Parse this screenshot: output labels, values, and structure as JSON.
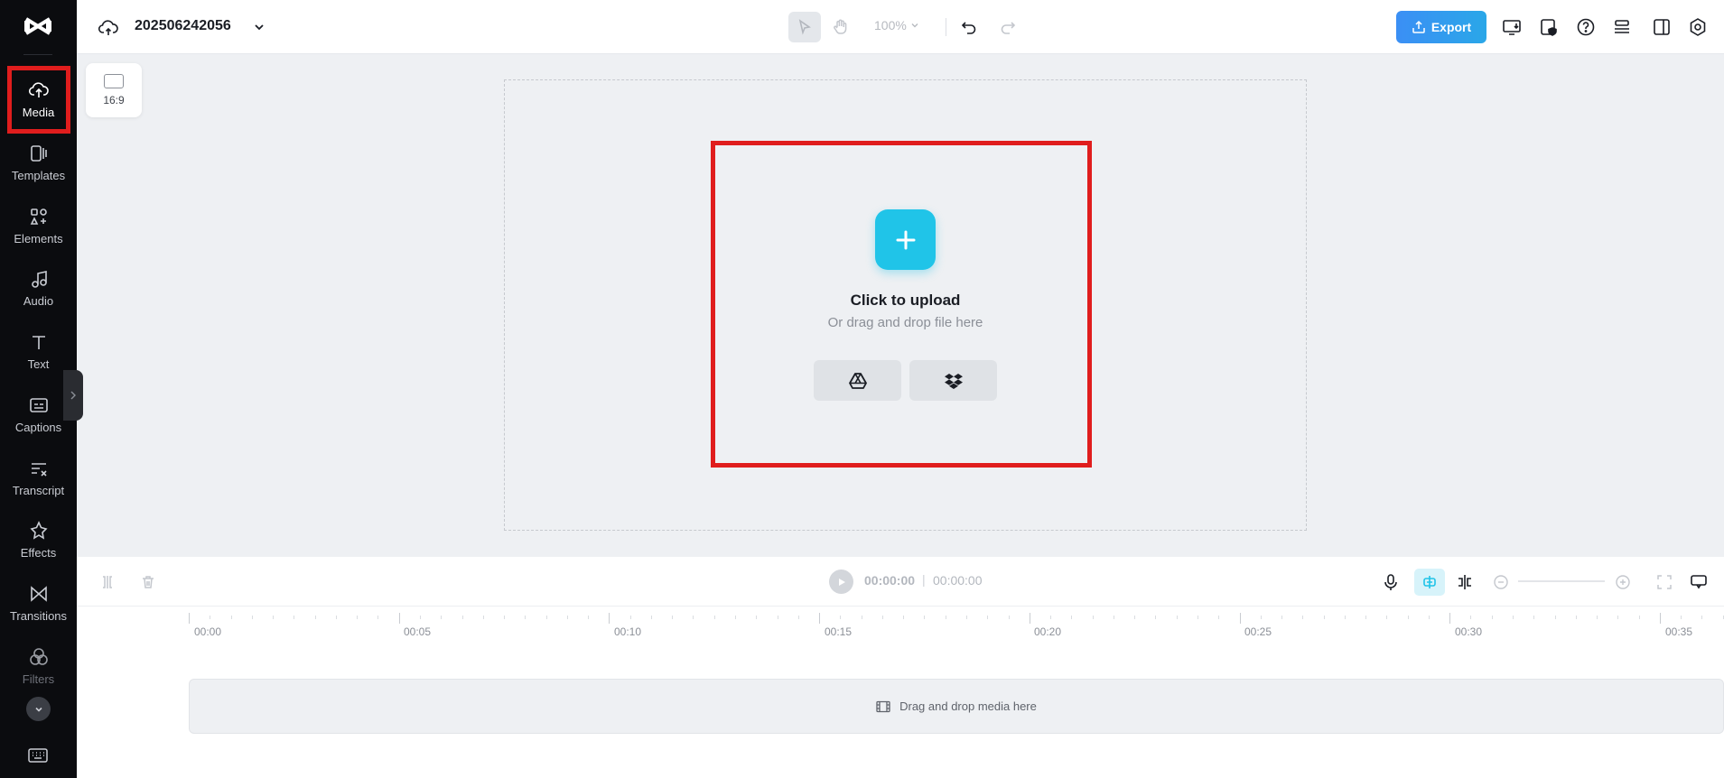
{
  "sidebar": {
    "items": [
      {
        "label": "Media",
        "icon": "cloud-upload-icon"
      },
      {
        "label": "Templates",
        "icon": "templates-icon"
      },
      {
        "label": "Elements",
        "icon": "elements-icon"
      },
      {
        "label": "Audio",
        "icon": "music-note-icon"
      },
      {
        "label": "Text",
        "icon": "text-icon"
      },
      {
        "label": "Captions",
        "icon": "captions-icon"
      },
      {
        "label": "Transcript",
        "icon": "transcript-icon"
      },
      {
        "label": "Effects",
        "icon": "effects-icon"
      },
      {
        "label": "Transitions",
        "icon": "transitions-icon"
      },
      {
        "label": "Filters",
        "icon": "filters-icon"
      }
    ],
    "active": "Media"
  },
  "header": {
    "project_name": "202506242056",
    "zoom": "100%",
    "export_label": "Export"
  },
  "canvas": {
    "aspect_ratio": "16:9",
    "upload_title": "Click to upload",
    "upload_subtitle": "Or drag and drop file here"
  },
  "timeline": {
    "current_time": "00:00:00",
    "separator": "|",
    "total_time": "00:00:00",
    "ticks": [
      "00:00",
      "00:05",
      "00:10",
      "00:15",
      "00:20",
      "00:25",
      "00:30",
      "00:35"
    ],
    "drop_hint": "Drag and drop media here"
  },
  "colors": {
    "accent": "#20c4e8",
    "export": "#3b8ff5",
    "highlight": "#e01d1d",
    "sidebar_bg": "#0b0c0f"
  }
}
